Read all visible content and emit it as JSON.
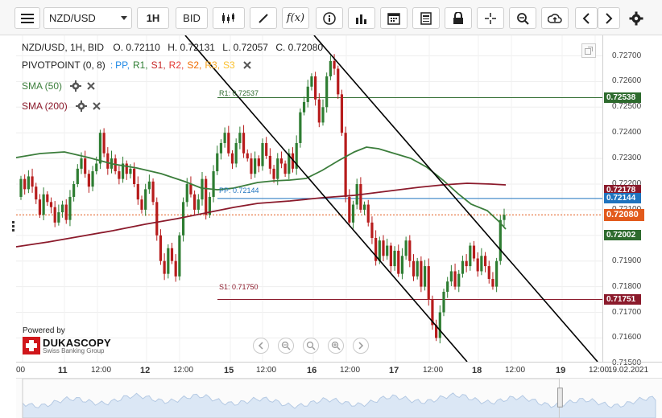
{
  "toolbar": {
    "symbol": "NZD/USD",
    "timeframe": "1H",
    "side": "BID",
    "function_label": "f(x)"
  },
  "info": {
    "title": "NZD/USD, 1H, BID",
    "open": "O. 0.72110",
    "high": "H. 0.72131",
    "low": "L. 0.72057",
    "close": "C. 0.72080"
  },
  "indicators": {
    "pivot": {
      "label": "PIVOTPOINT (0, 8)",
      "sep": ":",
      "levels": [
        {
          "text": "PP,",
          "color": "#1e88e5"
        },
        {
          "text": "R1,",
          "color": "#2e7d32"
        },
        {
          "text": "S1,",
          "color": "#c62828"
        },
        {
          "text": "R2,",
          "color": "#e53935"
        },
        {
          "text": "S2,",
          "color": "#ef6c00"
        },
        {
          "text": "R3,",
          "color": "#f9a825"
        },
        {
          "text": "S3",
          "color": "#fbc02d"
        }
      ]
    },
    "sma50": {
      "label": "SMA (50)",
      "color": "#3b7d3b"
    },
    "sma200": {
      "label": "SMA (200)",
      "color": "#8b1a2b"
    }
  },
  "levels_on_chart": {
    "r1": "R1: 0.72537",
    "pp": "PP: 0.72144",
    "s1": "S1: 0.71750"
  },
  "price_axis": {
    "ticks": [
      "0.72700",
      "0.72600",
      "0.72500",
      "0.72400",
      "0.72300",
      "0.72200",
      "0.72100",
      "0.72000",
      "0.71900",
      "0.71800",
      "0.71700",
      "0.71600",
      "0.71500"
    ],
    "tags": [
      {
        "value": "0.72538",
        "color": "#2e6b2e"
      },
      {
        "value": "0.72178",
        "color": "#8b1a2b"
      },
      {
        "value": "0.72144",
        "color": "#1e73be"
      },
      {
        "value": "0.72080",
        "color": "#e25a1c"
      },
      {
        "value": "0.72002",
        "color": "#2e6b2e"
      },
      {
        "value": "0.71751",
        "color": "#8b1a2b"
      }
    ]
  },
  "time_axis": {
    "labels": [
      {
        "text": "00",
        "big": false
      },
      {
        "text": "11",
        "big": true
      },
      {
        "text": "12:00",
        "big": false
      },
      {
        "text": "12",
        "big": true
      },
      {
        "text": "12:00",
        "big": false
      },
      {
        "text": "15",
        "big": true
      },
      {
        "text": "12:00",
        "big": false
      },
      {
        "text": "16",
        "big": true
      },
      {
        "text": "12:00",
        "big": false
      },
      {
        "text": "17",
        "big": true
      },
      {
        "text": "12:00",
        "big": false
      },
      {
        "text": "18",
        "big": true
      },
      {
        "text": "12:00",
        "big": false
      },
      {
        "text": "19",
        "big": true
      },
      {
        "text": "12:00",
        "big": false
      }
    ],
    "end_date": "19.02.2021"
  },
  "branding": {
    "powered_by": "Powered by",
    "name": "DUKASCOPY",
    "tagline": "Swiss Banking Group"
  },
  "colors": {
    "sma50": "#3b7d3b",
    "sma200": "#8b1a2b",
    "candle": "#2e7d32",
    "candle_down": "#c62828",
    "channel": "#000000",
    "last_price": "#e25a1c"
  }
}
